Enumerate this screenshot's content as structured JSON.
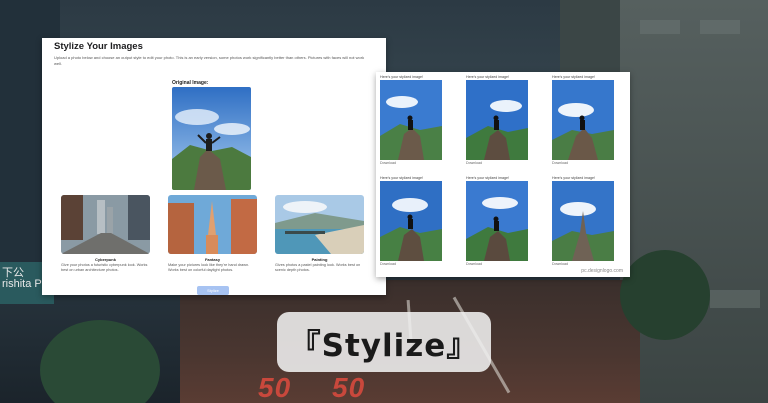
{
  "background": {
    "road_marking_1": "50",
    "road_marking_2": "50",
    "sign_text": "rishita Park",
    "sign_text_top": "下公"
  },
  "left_panel": {
    "title": "Stylize Your Images",
    "description": "Upload a photo below and choose an output style to edit your photo. This is an early version, some photos work significantly better than others. Pictures with faces will not work well.",
    "original_label": "Original Image:",
    "styles": [
      {
        "name": "Cyberpunk",
        "desc": "Give your photos a futuristic cyberpunk look. Works best on urban architecture photos."
      },
      {
        "name": "Fantasy",
        "desc": "Make your pictures look like they're hand drawn. Works best on colorful daylight photos."
      },
      {
        "name": "Painting",
        "desc": "Gives photos a pastel painting look. Works best on scenic depth photos."
      }
    ],
    "button_label": "Stylize"
  },
  "right_panel": {
    "result_header": "Here's your stylized image!",
    "download_label": "Download",
    "watermark": "pc.designlogo.com"
  },
  "caption": "『Stylize』"
}
